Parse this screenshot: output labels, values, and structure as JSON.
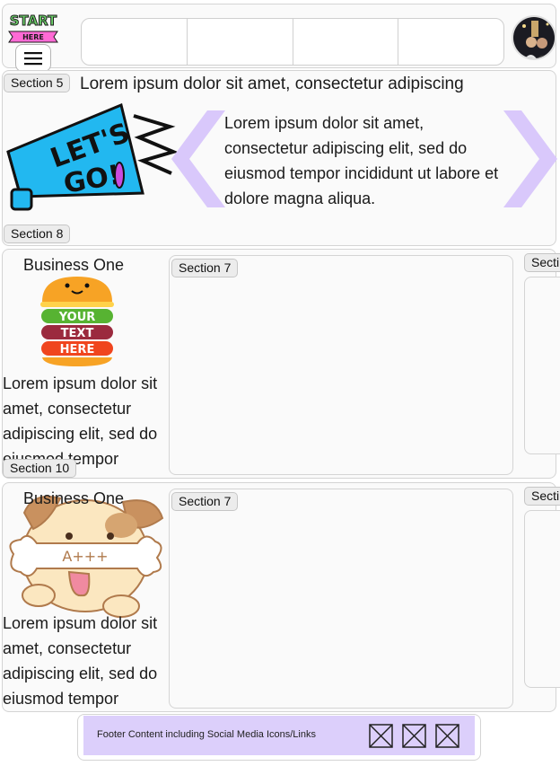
{
  "colors": {
    "hero_chevron": "#d9c8fb",
    "footer_bg": "#dccffb",
    "megaphone_body": "#22b8f0",
    "logo_green": "#6dd36b",
    "logo_pink": "#ff6ad5"
  },
  "header": {
    "logo_lines": [
      "START",
      "HERE"
    ],
    "menu_icon": "hamburger-icon",
    "nav_items": [
      "",
      "",
      "",
      ""
    ],
    "avatar": "profile-photo"
  },
  "hero": {
    "section_label": "Section 5",
    "title": "Lorem ipsum dolor sit amet, consectetur adipiscing",
    "body": "Lorem ipsum dolor sit amet, consectetur adipiscing elit, sed do eiusmod tempor incididunt ut labore et dolore magna aliqua.",
    "sticker_text": "LET'S GO!",
    "prev_icon": "chevron-left-icon",
    "next_icon": "chevron-right-icon"
  },
  "section8_label": "Section 8",
  "section10_label": "Section 10",
  "rows": [
    {
      "title": "Business One",
      "sticker_lines": [
        "YOUR",
        "TEXT",
        "HERE"
      ],
      "text": "Lorem ipsum dolor sit amet, consectetur adipiscing elit, sed do eiusmod tempor",
      "inner_label": "Section 7",
      "side_label": "Secti"
    },
    {
      "title": "Business One",
      "sticker_text": "A+++",
      "text": "Lorem ipsum dolor sit amet, consectetur adipiscing elit, sed do eiusmod tempor",
      "inner_label": "Section 7",
      "side_label": "Secti"
    }
  ],
  "footer": {
    "text": "Footer Content including Social Media Icons/Links",
    "icons": [
      "social-icon-placeholder",
      "social-icon-placeholder",
      "social-icon-placeholder"
    ]
  }
}
